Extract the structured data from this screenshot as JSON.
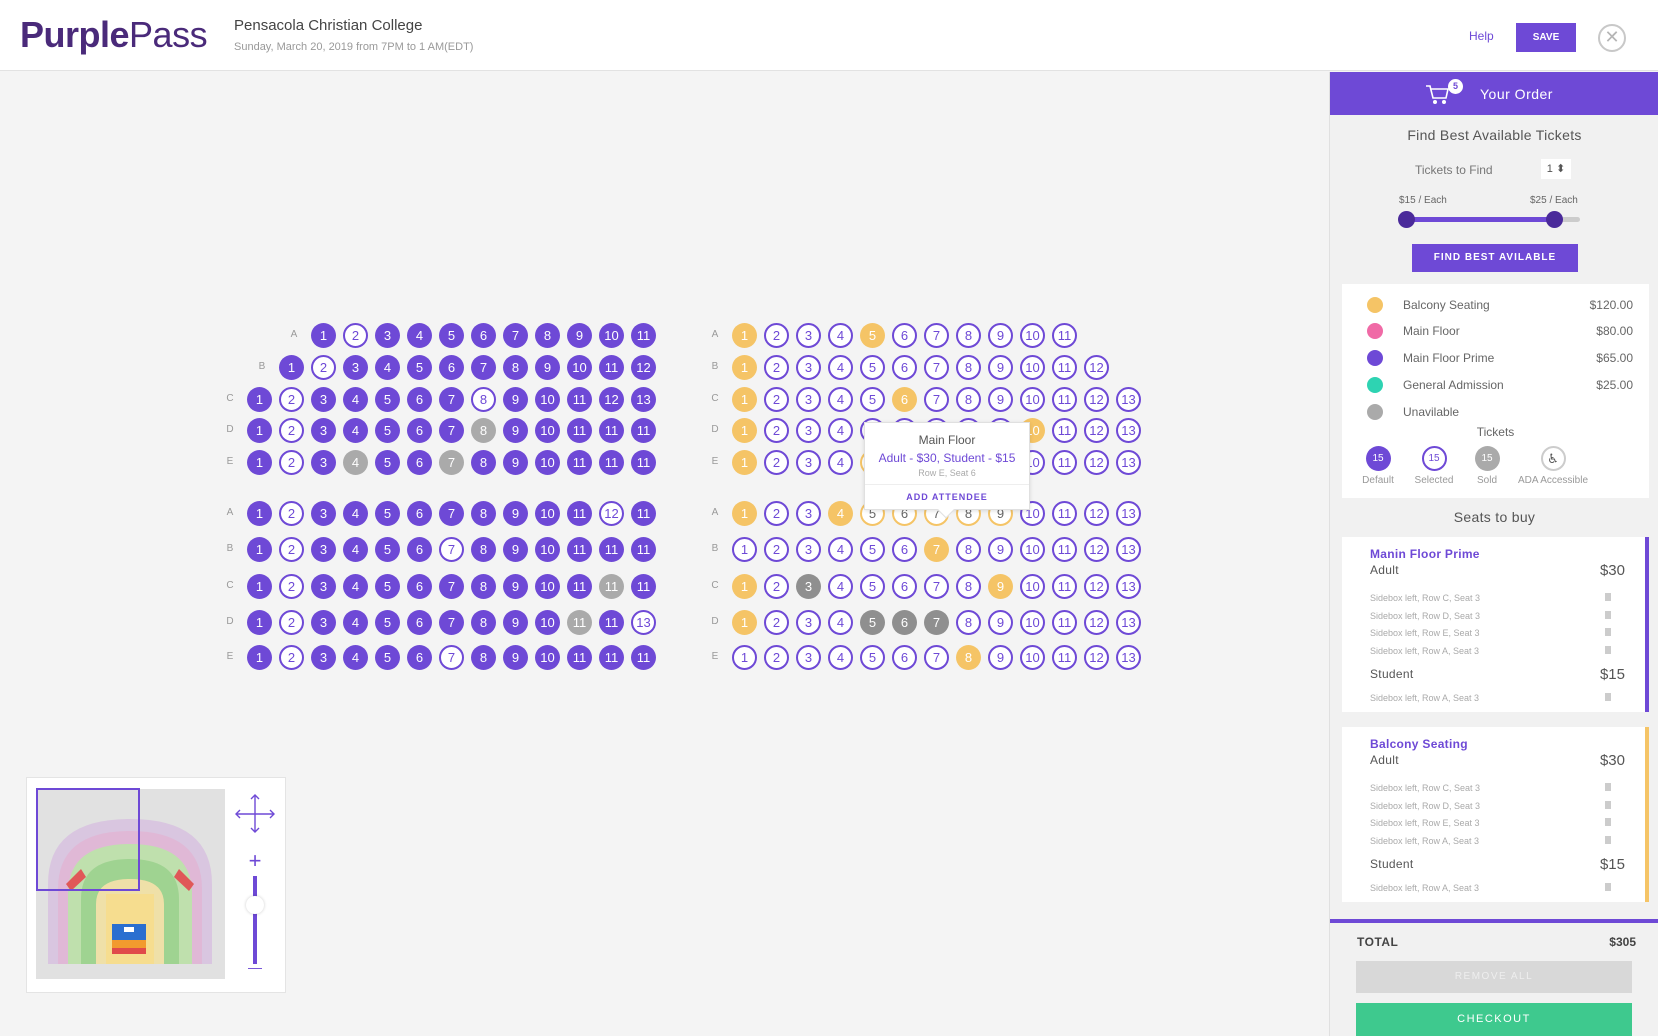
{
  "header": {
    "logo_bold": "Purple",
    "logo_light": "Pass",
    "event_title": "Pensacola Christian College",
    "event_subtitle": "Sunday, March 20, 2019 from 7PM to 1 AM(EDT)",
    "help_label": "Help",
    "save_label": "SAVE",
    "close_icon": "close-icon"
  },
  "seat_sections": {
    "left_top": {
      "rows": [
        "A",
        "B",
        "C",
        "D",
        "E"
      ],
      "seats": {
        "A": [
          "1",
          "2",
          "3",
          "4",
          "5",
          "6",
          "7",
          "8",
          "9",
          "10",
          "11"
        ],
        "B": [
          "1",
          "2",
          "3",
          "4",
          "5",
          "6",
          "7",
          "8",
          "9",
          "10",
          "11",
          "12"
        ],
        "C": [
          "1",
          "2",
          "3",
          "4",
          "5",
          "6",
          "7",
          "8",
          "9",
          "10",
          "11",
          "12",
          "13"
        ],
        "D": [
          "1",
          "2",
          "3",
          "4",
          "5",
          "6",
          "7",
          "8",
          "9",
          "10",
          "11",
          "11",
          "11"
        ],
        "E": [
          "1",
          "2",
          "3",
          "4",
          "5",
          "6",
          "7",
          "8",
          "9",
          "10",
          "11",
          "11",
          "11"
        ]
      },
      "status": {
        "A": [
          "p",
          "o",
          "p",
          "p",
          "p",
          "p",
          "p",
          "p",
          "p",
          "p",
          "p"
        ],
        "B": [
          "p",
          "o",
          "p",
          "p",
          "p",
          "p",
          "p",
          "p",
          "p",
          "p",
          "p",
          "p"
        ],
        "C": [
          "p",
          "o",
          "p",
          "p",
          "p",
          "p",
          "p",
          "o",
          "p",
          "p",
          "p",
          "p",
          "p"
        ],
        "D": [
          "p",
          "o",
          "p",
          "p",
          "p",
          "p",
          "p",
          "g",
          "p",
          "p",
          "p",
          "p",
          "p"
        ],
        "E": [
          "p",
          "o",
          "p",
          "g",
          "p",
          "p",
          "g",
          "p",
          "p",
          "p",
          "p",
          "p",
          "p"
        ]
      }
    },
    "left_bottom": {
      "rows": [
        "A",
        "B",
        "C",
        "D",
        "E"
      ],
      "seats": {
        "A": [
          "1",
          "2",
          "3",
          "4",
          "5",
          "6",
          "7",
          "8",
          "9",
          "10",
          "11",
          "12",
          "11"
        ],
        "B": [
          "1",
          "2",
          "3",
          "4",
          "5",
          "6",
          "7",
          "8",
          "9",
          "10",
          "11",
          "11",
          "11"
        ],
        "C": [
          "1",
          "2",
          "3",
          "4",
          "5",
          "6",
          "7",
          "8",
          "9",
          "10",
          "11",
          "11",
          "11"
        ],
        "D": [
          "1",
          "2",
          "3",
          "4",
          "5",
          "6",
          "7",
          "8",
          "9",
          "10",
          "11",
          "11",
          "13"
        ],
        "E": [
          "1",
          "2",
          "3",
          "4",
          "5",
          "6",
          "7",
          "8",
          "9",
          "10",
          "11",
          "11",
          "11"
        ]
      },
      "status": {
        "A": [
          "p",
          "o",
          "p",
          "p",
          "p",
          "p",
          "p",
          "p",
          "p",
          "p",
          "p",
          "o",
          "p"
        ],
        "B": [
          "p",
          "o",
          "p",
          "p",
          "p",
          "p",
          "o",
          "p",
          "p",
          "p",
          "p",
          "p",
          "p"
        ],
        "C": [
          "p",
          "o",
          "p",
          "p",
          "p",
          "p",
          "p",
          "p",
          "p",
          "p",
          "p",
          "g",
          "p"
        ],
        "D": [
          "p",
          "o",
          "p",
          "p",
          "p",
          "p",
          "p",
          "p",
          "p",
          "p",
          "g",
          "p",
          "o"
        ],
        "E": [
          "p",
          "o",
          "p",
          "p",
          "p",
          "p",
          "o",
          "p",
          "p",
          "p",
          "p",
          "p",
          "p"
        ]
      }
    },
    "right_top": {
      "rows": [
        "A",
        "B",
        "C",
        "D",
        "E"
      ],
      "seats": {
        "A": [
          "1",
          "2",
          "3",
          "4",
          "5",
          "6",
          "7",
          "8",
          "9",
          "10",
          "11"
        ],
        "B": [
          "1",
          "2",
          "3",
          "4",
          "5",
          "6",
          "7",
          "8",
          "9",
          "10",
          "11",
          "12"
        ],
        "C": [
          "1",
          "2",
          "3",
          "4",
          "5",
          "6",
          "7",
          "8",
          "9",
          "10",
          "11",
          "12",
          "13"
        ],
        "D": [
          "1",
          "2",
          "3",
          "4",
          "5",
          "6",
          "7",
          "8",
          "9",
          "10",
          "11",
          "12",
          "13"
        ],
        "E": [
          "1",
          "2",
          "3",
          "4",
          "5",
          "6",
          "7",
          "8",
          "9",
          "10",
          "11",
          "12",
          "13"
        ]
      },
      "status": {
        "A": [
          "y",
          "o",
          "o",
          "o",
          "y",
          "o",
          "o",
          "o",
          "o",
          "o",
          "o"
        ],
        "B": [
          "y",
          "o",
          "o",
          "o",
          "o",
          "o",
          "o",
          "o",
          "o",
          "o",
          "o",
          "o"
        ],
        "C": [
          "y",
          "o",
          "o",
          "o",
          "o",
          "y",
          "o",
          "o",
          "o",
          "o",
          "o",
          "o",
          "o"
        ],
        "D": [
          "y",
          "o",
          "o",
          "o",
          "o",
          "o",
          "o",
          "o",
          "o",
          "y",
          "o",
          "o",
          "o"
        ],
        "E": [
          "y",
          "o",
          "o",
          "o",
          "h",
          "h",
          "h",
          "h",
          "h",
          "o",
          "o",
          "o",
          "o"
        ]
      }
    },
    "right_bottom": {
      "rows": [
        "A",
        "B",
        "C",
        "D",
        "E"
      ],
      "seats": {
        "A": [
          "1",
          "2",
          "3",
          "4",
          "5",
          "6",
          "7",
          "8",
          "9",
          "10",
          "11",
          "12",
          "13"
        ],
        "B": [
          "1",
          "2",
          "3",
          "4",
          "5",
          "6",
          "7",
          "8",
          "9",
          "10",
          "11",
          "12",
          "13"
        ],
        "C": [
          "1",
          "2",
          "3",
          "4",
          "5",
          "6",
          "7",
          "8",
          "9",
          "10",
          "11",
          "12",
          "13"
        ],
        "D": [
          "1",
          "2",
          "3",
          "4",
          "5",
          "6",
          "7",
          "8",
          "9",
          "10",
          "11",
          "12",
          "13"
        ],
        "E": [
          "1",
          "2",
          "3",
          "4",
          "5",
          "6",
          "7",
          "8",
          "9",
          "10",
          "11",
          "12",
          "13"
        ]
      },
      "status": {
        "A": [
          "y",
          "o",
          "o",
          "y",
          "h",
          "h",
          "h",
          "h",
          "h",
          "o",
          "o",
          "o",
          "o"
        ],
        "B": [
          "o",
          "o",
          "o",
          "o",
          "o",
          "o",
          "y",
          "o",
          "o",
          "o",
          "o",
          "o",
          "o"
        ],
        "C": [
          "y",
          "o",
          "d",
          "o",
          "o",
          "o",
          "o",
          "o",
          "y",
          "o",
          "o",
          "o",
          "o"
        ],
        "D": [
          "y",
          "o",
          "o",
          "o",
          "d",
          "d",
          "d",
          "o",
          "o",
          "o",
          "o",
          "o",
          "o"
        ],
        "E": [
          "o",
          "o",
          "o",
          "o",
          "o",
          "o",
          "o",
          "y",
          "o",
          "o",
          "o",
          "o",
          "o"
        ]
      }
    }
  },
  "popup": {
    "section": "Main Floor",
    "prices": "Adult - $30, Student - $15",
    "location": "Row E, Seat 6",
    "action": "ADD ATTENDEE"
  },
  "minimap": {
    "pan_icon": "pan-arrows-icon",
    "zoom_in": "+",
    "zoom_out": "—",
    "zoom_level": 0.75
  },
  "order_panel": {
    "cart_count": "5",
    "title": "Your Order",
    "find_title": "Find Best Available Tickets",
    "tickets_to_find_label": "Tickets to Find",
    "tickets_to_find_value": "1 ⬍",
    "price_low": "$15 / Each",
    "price_high": "$25 / Each",
    "slider_low": 0,
    "slider_high": 0.85,
    "find_button": "FIND BEST AVILABLE",
    "legend": [
      {
        "name": "Balcony Seating",
        "price": "$120.00",
        "color": "#f5c466"
      },
      {
        "name": "Main Floor",
        "price": "$80.00",
        "color": "#f06aa6"
      },
      {
        "name": "Main Floor Prime",
        "price": "$65.00",
        "color": "#6e49d6"
      },
      {
        "name": "General Admission",
        "price": "$25.00",
        "color": "#2ed3b2"
      },
      {
        "name": "Unavilable",
        "price": "",
        "color": "#aaaaaa"
      }
    ],
    "tickets_head": "Tickets",
    "ticket_states": [
      {
        "value": "15",
        "label": "Default"
      },
      {
        "value": "15",
        "label": "Selected"
      },
      {
        "value": "15",
        "label": "Sold"
      },
      {
        "value": "♿",
        "label": "ADA Accessible"
      }
    ],
    "seats_to_buy": "Seats to buy",
    "cards": [
      {
        "title": "Manin Floor Prime",
        "adult_label": "Adult",
        "adult_price": "$30",
        "adult_lines": [
          "Sidebox left, Row C, Seat 3",
          "Sidebox left, Row D, Seat 3",
          "Sidebox left, Row E, Seat 3",
          "Sidebox left, Row A, Seat 3"
        ],
        "student_label": "Student",
        "student_price": "$15",
        "student_lines": [
          "Sidebox left, Row A, Seat 3"
        ]
      },
      {
        "title": "Balcony Seating",
        "adult_label": "Adult",
        "adult_price": "$30",
        "adult_lines": [
          "Sidebox left, Row C, Seat 3",
          "Sidebox left, Row D, Seat 3",
          "Sidebox left, Row E, Seat 3",
          "Sidebox left, Row A, Seat 3"
        ],
        "student_label": "Student",
        "student_price": "$15",
        "student_lines": [
          "Sidebox left, Row A, Seat 3"
        ]
      }
    ],
    "total_label": "TOTAL",
    "total_value": "$305",
    "remove_all": "REMOVE ALL",
    "checkout": "CHECKOUT",
    "colors": {
      "accent": "#6e49d6",
      "checkout": "#3ec98e",
      "balcony": "#f5c466"
    }
  }
}
